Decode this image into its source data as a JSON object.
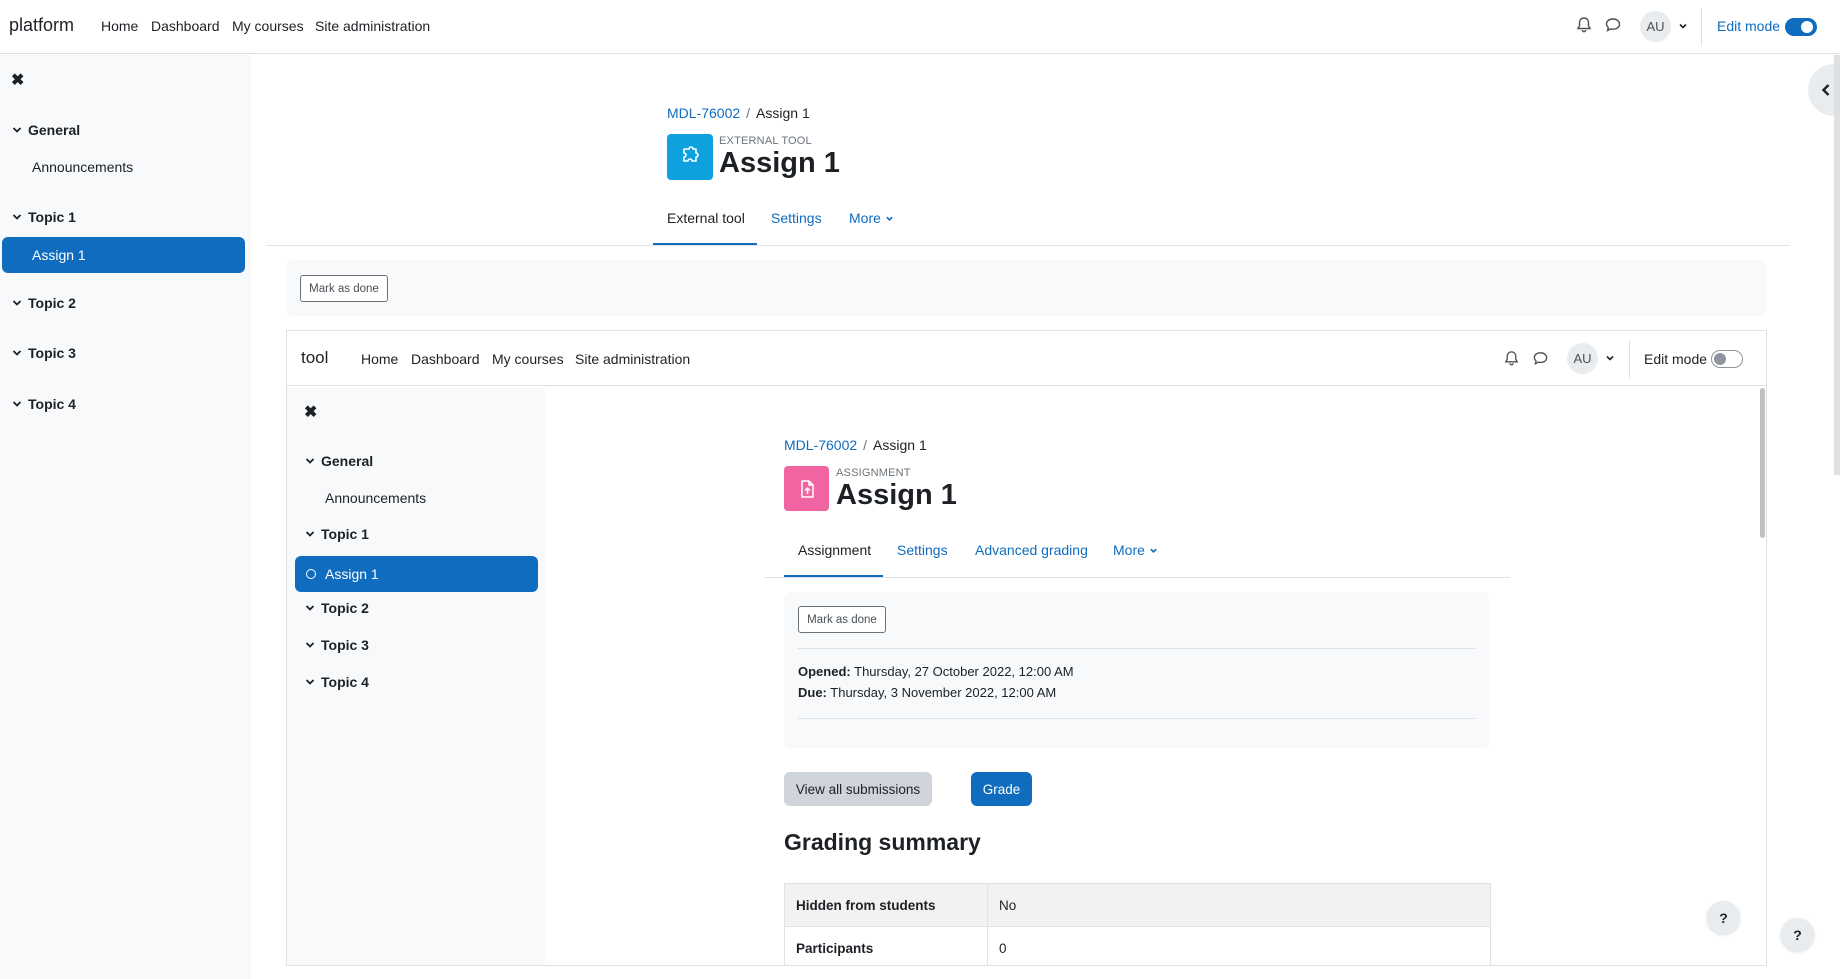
{
  "outer": {
    "brand": "platform",
    "nav": [
      "Home",
      "Dashboard",
      "My courses",
      "Site administration"
    ],
    "user_initials": "AU",
    "edit_mode_label": "Edit mode",
    "edit_mode_on": true,
    "sidebar": {
      "close_glyph": "✖",
      "sections": [
        {
          "label": "General",
          "items": [
            "Announcements"
          ]
        },
        {
          "label": "Topic 1",
          "items": [
            "Assign 1"
          ]
        },
        {
          "label": "Topic 2",
          "items": []
        },
        {
          "label": "Topic 3",
          "items": []
        },
        {
          "label": "Topic 4",
          "items": []
        }
      ]
    },
    "breadcrumb": {
      "course": "MDL-76002",
      "current": "Assign 1"
    },
    "module_type": "EXTERNAL TOOL",
    "title": "Assign 1",
    "tabs": [
      "External tool",
      "Settings",
      "More"
    ],
    "mark_done": "Mark as done"
  },
  "inner": {
    "brand": "tool",
    "nav": [
      "Home",
      "Dashboard",
      "My courses",
      "Site administration"
    ],
    "user_initials": "AU",
    "edit_mode_label": "Edit mode",
    "edit_mode_on": false,
    "sidebar": {
      "close_glyph": "✖",
      "sections": [
        {
          "label": "General",
          "items": [
            "Announcements"
          ]
        },
        {
          "label": "Topic 1",
          "items": [
            "Assign 1"
          ]
        },
        {
          "label": "Topic 2",
          "items": []
        },
        {
          "label": "Topic 3",
          "items": []
        },
        {
          "label": "Topic 4",
          "items": []
        }
      ]
    },
    "breadcrumb": {
      "course": "MDL-76002",
      "current": "Assign 1"
    },
    "module_type": "ASSIGNMENT",
    "title": "Assign 1",
    "tabs": [
      "Assignment",
      "Settings",
      "Advanced grading",
      "More"
    ],
    "mark_done": "Mark as done",
    "dates": {
      "opened_label": "Opened:",
      "opened_value": "Thursday, 27 October 2022, 12:00 AM",
      "due_label": "Due:",
      "due_value": "Thursday, 3 November 2022, 12:00 AM"
    },
    "buttons": {
      "view_all": "View all submissions",
      "grade": "Grade"
    },
    "grading_summary_title": "Grading summary",
    "summary_rows": [
      {
        "label": "Hidden from students",
        "value": "No"
      },
      {
        "label": "Participants",
        "value": "0"
      }
    ]
  },
  "help_glyph": "?",
  "colors": {
    "primary": "#0f6cbf",
    "assignment_icon": "#f164a2",
    "external_tool_icon": "#0fa0e0",
    "sidebar_bg": "#f8f9fa"
  }
}
